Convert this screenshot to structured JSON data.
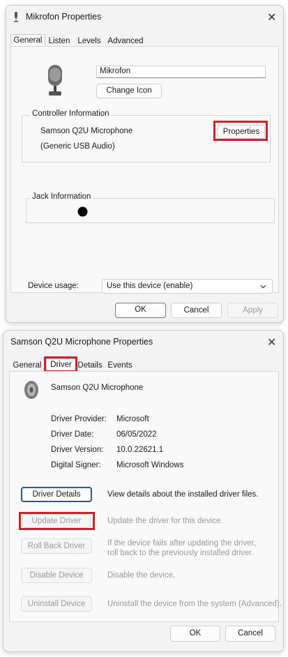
{
  "dialog1": {
    "title": "Mikrofon Properties",
    "close_symbol": "✕",
    "tabs": [
      "General",
      "Listen",
      "Levels",
      "Advanced"
    ],
    "device_name_value": "Mikrofon",
    "change_icon_label": "Change Icon",
    "controller_info_label": "Controller Information",
    "controller_name": "Samson Q2U Microphone",
    "controller_type": "(Generic USB Audio)",
    "properties_label": "Properties",
    "jack_info_label": "Jack Information",
    "device_usage_label": "Device usage:",
    "device_usage_value": "Use this device (enable)",
    "buttons": {
      "ok": "OK",
      "cancel": "Cancel",
      "apply": "Apply"
    }
  },
  "dialog2": {
    "title": "Samson Q2U Microphone Properties",
    "close_symbol": "✕",
    "tabs": [
      "General",
      "Driver",
      "Details",
      "Events"
    ],
    "device_name": "Samson Q2U Microphone",
    "info": [
      {
        "label": "Driver Provider:",
        "value": "Microsoft"
      },
      {
        "label": "Driver Date:",
        "value": "06/05/2022"
      },
      {
        "label": "Driver Version:",
        "value": "10.0.22621.1"
      },
      {
        "label": "Digital Signer:",
        "value": "Microsoft Windows"
      }
    ],
    "actions": [
      {
        "label": "Driver Details",
        "desc": "View details about the installed driver files."
      },
      {
        "label": "Update Driver",
        "desc": "Update the driver for this device."
      },
      {
        "label": "Roll Back Driver",
        "desc": "If the device fails after updating the driver, roll back to the previously installed driver."
      },
      {
        "label": "Disable Device",
        "desc": "Disable the device."
      },
      {
        "label": "Uninstall Device",
        "desc": "Uninstall the device from the system (Advanced)."
      }
    ],
    "buttons": {
      "ok": "OK",
      "cancel": "Cancel"
    }
  },
  "colors": {
    "highlight": "#d0202a",
    "focus": "#1e5aa8"
  },
  "icons": [
    "microphone-icon",
    "speaker-icon",
    "close-icon",
    "dropdown-chevron-icon",
    "jack-dot-icon"
  ]
}
